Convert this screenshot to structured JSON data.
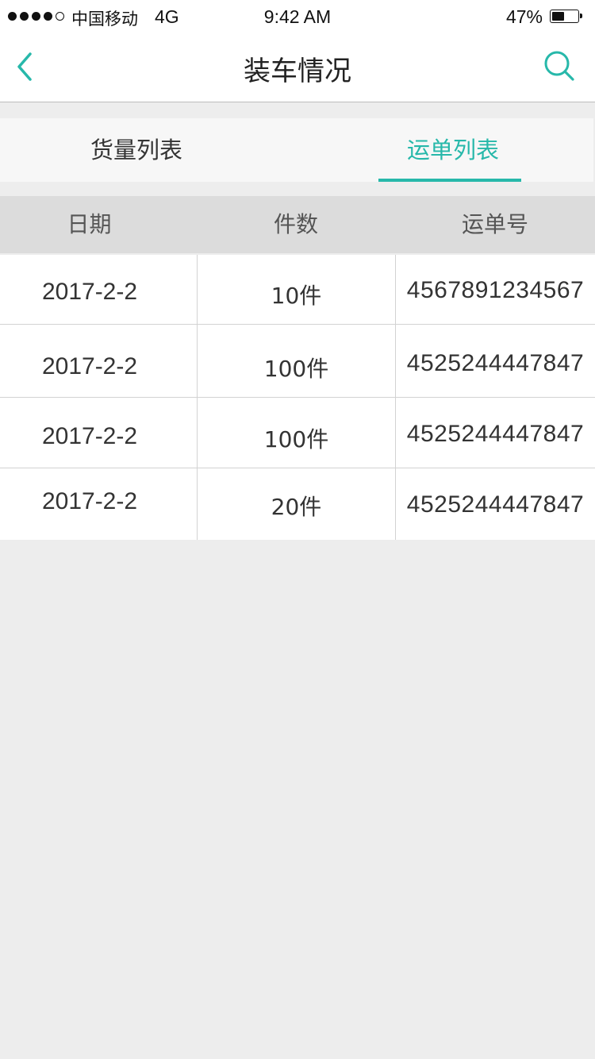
{
  "status_bar": {
    "signal_dots": 5,
    "signal_filled": 4,
    "carrier": "中国移动",
    "network": "4G",
    "time": "9:42 AM",
    "battery_percent_label": "47%",
    "battery_level": 0.47
  },
  "nav": {
    "title": "装车情况",
    "back_icon": "chevron-left-icon",
    "search_icon": "search-icon",
    "accent_color": "#27b8aa"
  },
  "tabs": [
    {
      "label": "货量列表",
      "active": false
    },
    {
      "label": "运单列表",
      "active": true
    }
  ],
  "table": {
    "headers": [
      "日期",
      "件数",
      "运单号"
    ],
    "rows": [
      {
        "date": "2017-2-2",
        "count": "10件",
        "waybill": "4567891234567"
      },
      {
        "date": "2017-2-2",
        "count": "100件",
        "waybill": "4525244447847"
      },
      {
        "date": "2017-2-2",
        "count": "100件",
        "waybill": "4525244447847"
      },
      {
        "date": "2017-2-2",
        "count": "20件",
        "waybill": "4525244447847"
      }
    ]
  }
}
